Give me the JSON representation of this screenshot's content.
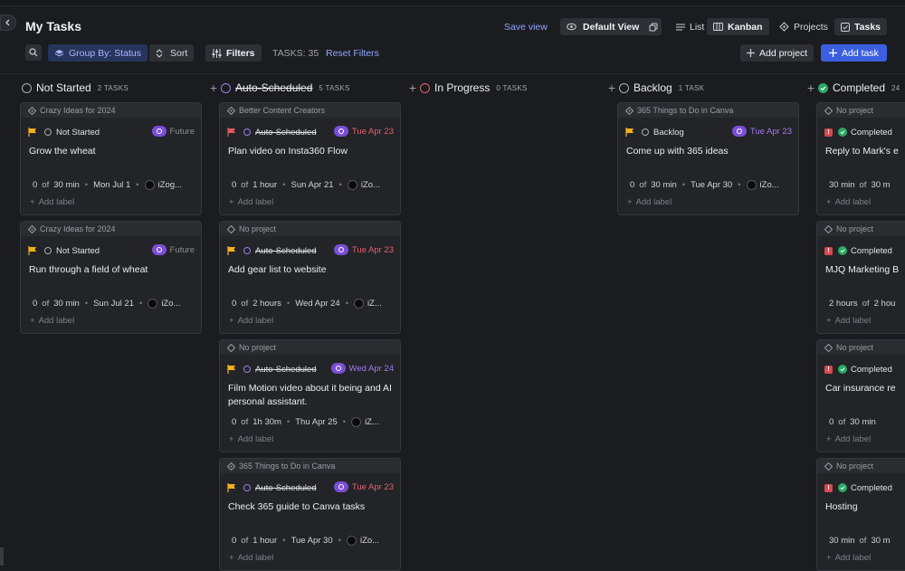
{
  "page": {
    "title": "My Tasks"
  },
  "header": {
    "save_view": "Save view",
    "default_view": "Default View",
    "list": "List",
    "kanban": "Kanban",
    "projects": "Projects",
    "tasks": "Tasks"
  },
  "toolbar": {
    "group_by": "Group By: Status",
    "sort": "Sort",
    "filters": "Filters",
    "task_count": "TASKS: 35",
    "reset_filters": "Reset Filters",
    "add_project": "Add project",
    "add_task": "Add task"
  },
  "columns": [
    {
      "title": "Not Started",
      "count": "2 TASKS"
    },
    {
      "title": "Auto-Scheduled",
      "count": "5 TASKS"
    },
    {
      "title": "In Progress",
      "count": "0 TASKS"
    },
    {
      "title": "Backlog",
      "count": "1 TASK"
    },
    {
      "title": "Completed",
      "count": "24"
    }
  ],
  "common": {
    "of": "of",
    "add_label": "Add label",
    "future": "Future"
  },
  "cards": {
    "ns1": {
      "project": "Crazy Ideas for 2024",
      "status": "Not Started",
      "title": "Grow the wheat",
      "done": "0",
      "total": "30 min",
      "date": "Mon Jul 1",
      "assignee": "iZog..."
    },
    "ns2": {
      "project": "Crazy Ideas for 2024",
      "status": "Not Started",
      "title": "Run through a field of wheat",
      "done": "0",
      "total": "30 min",
      "date": "Sun Jul 21",
      "assignee": "iZo..."
    },
    "as1": {
      "project": "Better Content Creators",
      "status": "Auto-Scheduled",
      "pill_date": "Tue Apr 23",
      "title": "Plan video on Insta360 Flow",
      "done": "0",
      "total": "1 hour",
      "date": "Sun Apr 21",
      "assignee": "iZo..."
    },
    "as2": {
      "project": "No project",
      "status": "Auto-Scheduled",
      "pill_date": "Tue Apr 23",
      "title": "Add gear list to website",
      "done": "0",
      "total": "2 hours",
      "date": "Wed Apr 24",
      "assignee": "iZ..."
    },
    "as3": {
      "project": "No project",
      "status": "Auto-Scheduled",
      "pill_date": "Wed Apr 24",
      "title": "Film Motion video about it being and AI personal assistant.",
      "done": "0",
      "total": "1h 30m",
      "date": "Thu Apr 25",
      "assignee": "iZ..."
    },
    "as4": {
      "project": "365 Things to Do in Canva",
      "status": "Auto-Scheduled",
      "pill_date": "Tue Apr 23",
      "title": "Check 365 guide to Canva tasks",
      "done": "0",
      "total": "1 hour",
      "date": "Tue Apr 30",
      "assignee": "iZo..."
    },
    "bl1": {
      "project": "365 Things to Do in Canva",
      "status": "Backlog",
      "pill_date": "Tue Apr 23",
      "title": "Come up with 365 ideas",
      "done": "0",
      "total": "30 min",
      "date": "Tue Apr 30",
      "assignee": "iZo..."
    },
    "cp1": {
      "project": "No project",
      "status": "Completed",
      "title": "Reply to Mark's e",
      "done": "30 min",
      "total": "30 m"
    },
    "cp2": {
      "project": "No project",
      "status": "Completed",
      "title": "MJQ Marketing B",
      "done": "2 hours",
      "total": "2 hou"
    },
    "cp3": {
      "project": "No project",
      "status": "Completed",
      "title": "Car insurance re",
      "done": "0",
      "total": "30 min"
    },
    "cp4": {
      "project": "No project",
      "status": "Completed",
      "title": "Hosting",
      "done": "30 min",
      "total": "30 m"
    }
  },
  "colors": {
    "accent": "#3c5fe0",
    "purple": "#a07cf0",
    "red": "#e0626a",
    "green": "#2aa866",
    "flag_yellow": "#f2b01e",
    "flag_red": "#e0575e"
  }
}
